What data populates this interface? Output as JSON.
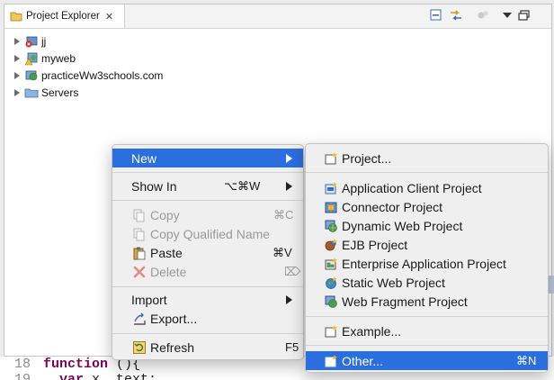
{
  "view": {
    "tab_title": "Project Explorer",
    "tab_close": "✕",
    "toolbar": [
      "collapse-all-icon",
      "link-with-editor-icon",
      "filter-icon",
      "view-menu-icon",
      "maximize-icon"
    ]
  },
  "tree": {
    "items": [
      {
        "label": "jj",
        "icon": "project-error-icon"
      },
      {
        "label": "myweb",
        "icon": "web-project-warning-icon"
      },
      {
        "label": "practiceWw3schools.com",
        "icon": "web-project-icon"
      },
      {
        "label": "Servers",
        "icon": "folder-icon"
      }
    ]
  },
  "editor": {
    "lines": [
      {
        "number": "18",
        "keyword": "function",
        "rest": " (){"
      },
      {
        "number": "19",
        "keyword": "var",
        "rest": " x, text;"
      }
    ]
  },
  "context_menu": {
    "new": {
      "label": "New",
      "arrow": true,
      "highlighted": true
    },
    "show_in": {
      "label": "Show In",
      "shortcut": "⌥⌘W",
      "arrow": true
    },
    "copy": {
      "label": "Copy",
      "shortcut": "⌘C",
      "disabled": true
    },
    "copy_qualified": {
      "label": "Copy Qualified Name",
      "disabled": true
    },
    "paste": {
      "label": "Paste",
      "shortcut": "⌘V"
    },
    "delete": {
      "label": "Delete",
      "shortcut": "⌦",
      "disabled": true
    },
    "import": {
      "label": "Import",
      "arrow": true
    },
    "export": {
      "label": "Export..."
    },
    "refresh": {
      "label": "Refresh",
      "shortcut": "F5"
    }
  },
  "submenu": {
    "project": {
      "label": "Project..."
    },
    "application_client": {
      "label": "Application Client Project"
    },
    "connector": {
      "label": "Connector Project"
    },
    "dynamic_web": {
      "label": "Dynamic Web Project"
    },
    "ejb": {
      "label": "EJB Project"
    },
    "enterprise_application": {
      "label": "Enterprise Application Project"
    },
    "static_web": {
      "label": "Static Web Project"
    },
    "web_fragment": {
      "label": "Web Fragment Project"
    },
    "example": {
      "label": "Example..."
    },
    "other": {
      "label": "Other...",
      "shortcut": "⌘N",
      "highlighted": true
    }
  },
  "colors": {
    "highlight": "#2a6edf",
    "menu_bg": "#efefef",
    "keyword": "#7f0055"
  }
}
